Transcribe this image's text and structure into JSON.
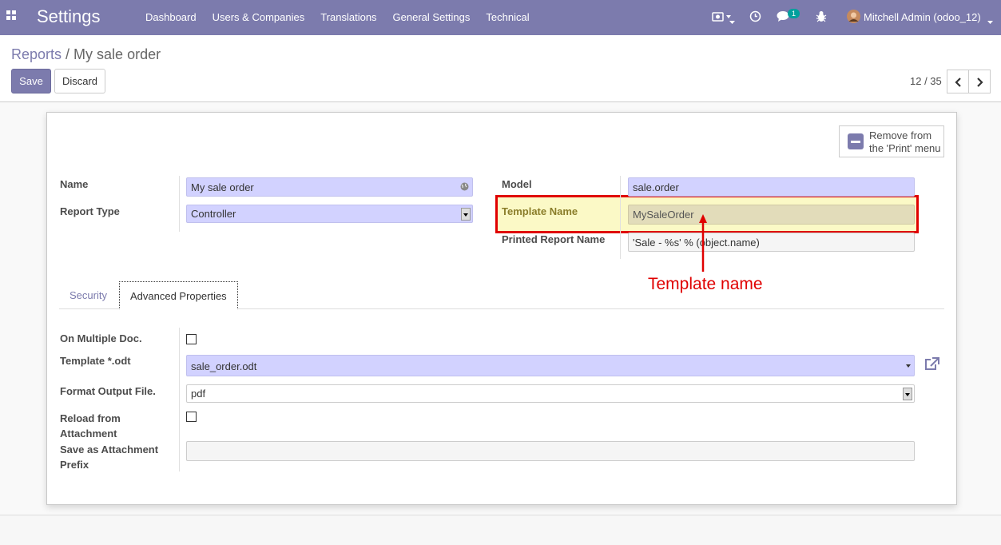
{
  "navbar": {
    "brand": "Settings",
    "menu": [
      "Dashboard",
      "Users & Companies",
      "Translations",
      "General Settings",
      "Technical"
    ],
    "chat_badge": "1",
    "user": "Mitchell Admin (odoo_12)"
  },
  "breadcrumb": {
    "parent": "Reports",
    "separator": " / ",
    "current": "My sale order"
  },
  "buttons": {
    "save": "Save",
    "discard": "Discard"
  },
  "pager": {
    "text": "12 / 35"
  },
  "remove_print": {
    "line1": "Remove from",
    "line2": "the 'Print' menu"
  },
  "fields": {
    "name": {
      "label": "Name",
      "value": "My sale order"
    },
    "report_type": {
      "label": "Report Type",
      "value": "Controller"
    },
    "model": {
      "label": "Model",
      "value": "sale.order"
    },
    "template_name": {
      "label": "Template Name",
      "value": "MySaleOrder"
    },
    "printed_report_name": {
      "label": "Printed Report Name",
      "value": "'Sale - %s' % (object.name)"
    }
  },
  "annotation": {
    "text": "Template name",
    "color": "#e00000"
  },
  "tabs": {
    "security": "Security",
    "advanced": "Advanced Properties"
  },
  "advanced": {
    "multiple_doc": {
      "label": "On Multiple Doc.",
      "checked": false
    },
    "template_odt": {
      "label": "Template *.odt",
      "value": "sale_order.odt"
    },
    "format_output": {
      "label": "Format Output File.",
      "value": "pdf"
    },
    "reload_attachment": {
      "label_line1": "Reload from",
      "label_line2": "Attachment",
      "checked": false
    },
    "attachment_prefix": {
      "label_line1": "Save as Attachment",
      "label_line2": "Prefix",
      "value": ""
    }
  },
  "colors": {
    "brand": "#7c7bad",
    "required_field": "#d2d2ff",
    "highlight": "#fbf9c6"
  }
}
